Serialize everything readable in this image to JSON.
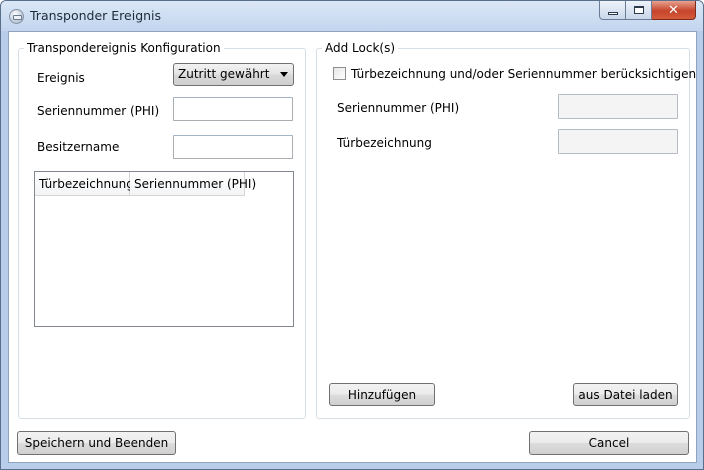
{
  "window": {
    "title": "Transponder Ereignis",
    "minimize_icon": "minimize-icon",
    "maximize_icon": "maximize-icon",
    "close_icon": "close-icon",
    "close_glyph": "✕"
  },
  "config_group": {
    "title": "Transpondereignis Konfiguration",
    "event_label": "Ereignis",
    "event_value": "Zutritt gewährt",
    "serial_label": "Seriennummer (PHI)",
    "serial_value": "",
    "owner_label": "Besitzername",
    "owner_value": "",
    "table_columns": [
      "Türbezeichnung",
      "Seriennummer (PHI)"
    ],
    "table_rows": []
  },
  "lock_group": {
    "title": "Add  Lock(s)",
    "checkbox_label": "Türbezeichnung und/oder Seriennummer berücksichtigen",
    "checkbox_checked": false,
    "serial_label": "Seriennummer (PHI)",
    "serial_value": "",
    "door_label": "Türbezeichnung",
    "door_value": "",
    "add_button": "Hinzufügen",
    "load_button": "aus Datei laden"
  },
  "footer": {
    "save_button": "Speichern und Beenden",
    "cancel_button": "Cancel"
  }
}
